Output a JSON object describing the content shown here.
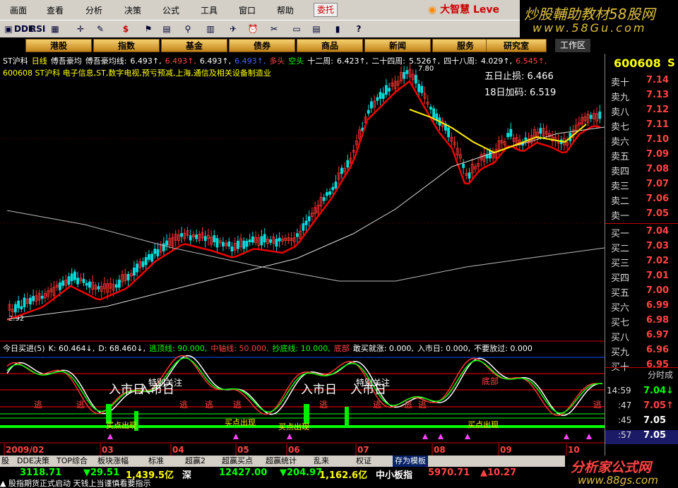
{
  "menu": [
    "画面",
    "查看",
    "分析",
    "决策",
    "公式",
    "工具",
    "窗口",
    "帮助"
  ],
  "entrust": "委托",
  "brand": "大智慧 Leve",
  "ad_top": {
    "line1": "炒股輔助教材58股网",
    "line2": "www.58Gu.com"
  },
  "toolbar_icons": [
    "window-icon",
    "dde-icon",
    "rsi-icon",
    "grid-icon",
    "crosshair-icon",
    "ruler-icon",
    "dollar-icon",
    "flag-icon",
    "table-icon",
    "binoculars-icon",
    "clipboard-icon",
    "trade-icon",
    "alarm-icon",
    "tools-icon",
    "layout-icon",
    "notes-icon",
    "bars-icon",
    "help-icon"
  ],
  "toolbar_labels": [
    "▣",
    "DDE",
    "RSI",
    "▦",
    "✛",
    "✎",
    "$",
    "⚑",
    "▤",
    "⚲",
    "▥",
    "✈",
    "⏰",
    "✂",
    "▭",
    "▤",
    "▮",
    "?"
  ],
  "nav": {
    "buttons": [
      "港股",
      "指数",
      "基金",
      "债券",
      "商品",
      "新闻",
      "服务",
      "研究室"
    ],
    "workarea": "工作区"
  },
  "chart_header": {
    "line1": [
      {
        "text": "ST沪科",
        "color": "#ffffff"
      },
      {
        "text": "日线",
        "color": "#ffff00"
      },
      {
        "text": "傅吾豪均",
        "color": "#ffffff"
      },
      {
        "text": "傅吾豪均线:",
        "color": "#ffffff"
      },
      {
        "text": "6.493↑,",
        "color": "#ffffff"
      },
      {
        "text": "6.493↑,",
        "color": "#ff4444"
      },
      {
        "text": "6.493↑,",
        "color": "#ffffff"
      },
      {
        "text": "6.493↑,",
        "color": "#4466ff"
      },
      {
        "text": "多头",
        "color": "#ff4444"
      },
      {
        "text": "空头",
        "color": "#00ff00"
      },
      {
        "text": "十二周:",
        "color": "#ffffff"
      },
      {
        "text": "6.423↑,",
        "color": "#ffffff"
      },
      {
        "text": "二十四周:",
        "color": "#ffffff"
      },
      {
        "text": "5.526↑,",
        "color": "#ffffff"
      },
      {
        "text": "四十八周:",
        "color": "#ffffff"
      },
      {
        "text": "4.029↑,",
        "color": "#ffffff"
      },
      {
        "text": "6.545↑,",
        "color": "#ff4444"
      }
    ],
    "line2": "600608 ST沪科 电子信息,ST,数字电视,预亏预减,上海,通信及相关设备制造业"
  },
  "annotations": {
    "stop_loss": "五日止损: 6.466",
    "add_pos": "18日加码: 6.519",
    "peak": "7.80",
    "low": "2.92"
  },
  "indicator_header": [
    {
      "text": "今日买进(5)",
      "color": "#ffffff"
    },
    {
      "text": "K: 60.464↓,",
      "color": "#ffffff"
    },
    {
      "text": "D: 68.460↓,",
      "color": "#ffffff"
    },
    {
      "text": "逃顶线: 90.000,",
      "color": "#00ff00"
    },
    {
      "text": "中轴线: 50.000,",
      "color": "#ff4444"
    },
    {
      "text": "抄底线: 10.000,",
      "color": "#00ff00"
    },
    {
      "text": "底部",
      "color": "#ff4444"
    },
    {
      "text": "敢买就涨: 0.000,",
      "color": "#ffffff"
    },
    {
      "text": "入市日: 0.000,",
      "color": "#ffffff"
    },
    {
      "text": "不要放过: 0.000",
      "color": "#ffffff"
    }
  ],
  "indicator_labels": {
    "big": [
      "入市日",
      "入市日",
      "入市日",
      "入市日"
    ],
    "special": [
      "特别关注",
      "特别关注"
    ],
    "escape": [
      "逃",
      "逃",
      "逃",
      "逃",
      "逃",
      "逃",
      "逃",
      "逃",
      "逃",
      "逃"
    ],
    "buy": [
      "买点出现",
      "买点出现",
      "买点出现",
      "买点出现"
    ],
    "bottom_label": "底部"
  },
  "x_axis": [
    "2009/02",
    "03",
    "04",
    "05",
    "06",
    "07",
    "08",
    "09",
    "10"
  ],
  "right_panel": {
    "code": "600608",
    "code_suffix": "S",
    "sell": [
      {
        "label": "卖十",
        "price": "7.14"
      },
      {
        "label": "卖九",
        "price": "7.13"
      },
      {
        "label": "卖八",
        "price": "7.12"
      },
      {
        "label": "卖七",
        "price": "7.11"
      },
      {
        "label": "卖六",
        "price": "7.10"
      },
      {
        "label": "卖五",
        "price": "7.09"
      },
      {
        "label": "卖四",
        "price": "7.08"
      },
      {
        "label": "卖三",
        "price": "7.07"
      },
      {
        "label": "卖二",
        "price": "7.06"
      },
      {
        "label": "卖一",
        "price": "7.05"
      }
    ],
    "buy": [
      {
        "label": "买一",
        "price": "7.04"
      },
      {
        "label": "买二",
        "price": "7.03"
      },
      {
        "label": "买三",
        "price": "7.02"
      },
      {
        "label": "买四",
        "price": "7.01"
      },
      {
        "label": "买五",
        "price": "7.00"
      },
      {
        "label": "买六",
        "price": "6.99"
      },
      {
        "label": "买七",
        "price": "6.98"
      },
      {
        "label": "买八",
        "price": "6.97"
      },
      {
        "label": "买九",
        "price": "6.96"
      },
      {
        "label": "买十",
        "price": "6.95"
      }
    ],
    "fenshi": "分时成",
    "ticks": [
      {
        "time": "14:59",
        "price": "7.04↓",
        "color": "#00ff00"
      },
      {
        "time": ":47",
        "price": "7.05↑",
        "color": "#ff4444"
      },
      {
        "time": ":45",
        "price": "7.05",
        "color": "#ffffff"
      },
      {
        "time": ":57",
        "price": "7.05",
        "color": "#ffffff"
      }
    ]
  },
  "status": {
    "tabs": [
      "股",
      "DDE决策",
      "TOP综合",
      "板块涨幅",
      "标准",
      "超赢2",
      "超赢买点",
      "超赢统计",
      "乱来",
      "权证",
      "存为模板"
    ],
    "indices": [
      {
        "text": "3118.71",
        "color": "#00ff00"
      },
      {
        "text": "▼29.51",
        "color": "#00ff00"
      },
      {
        "text": "1,439.5亿",
        "color": "#ffff00"
      },
      {
        "text": "深",
        "color": "#ffffff"
      },
      {
        "text": "12427.00",
        "color": "#00ff00"
      },
      {
        "text": "▼204.97",
        "color": "#00ff00"
      },
      {
        "text": "1,162.6亿",
        "color": "#ffff00"
      },
      {
        "text": "中小板指",
        "color": "#ffffff"
      },
      {
        "text": "5970.71",
        "color": "#ff4444"
      },
      {
        "text": "▲10.27",
        "color": "#ff4444"
      }
    ],
    "ticker": "▲ 股指期货正式启动 天钱上当谨慎看要指示",
    "ad": {
      "line1": "分析家公式网",
      "line2": "www.88gs.com"
    }
  }
}
